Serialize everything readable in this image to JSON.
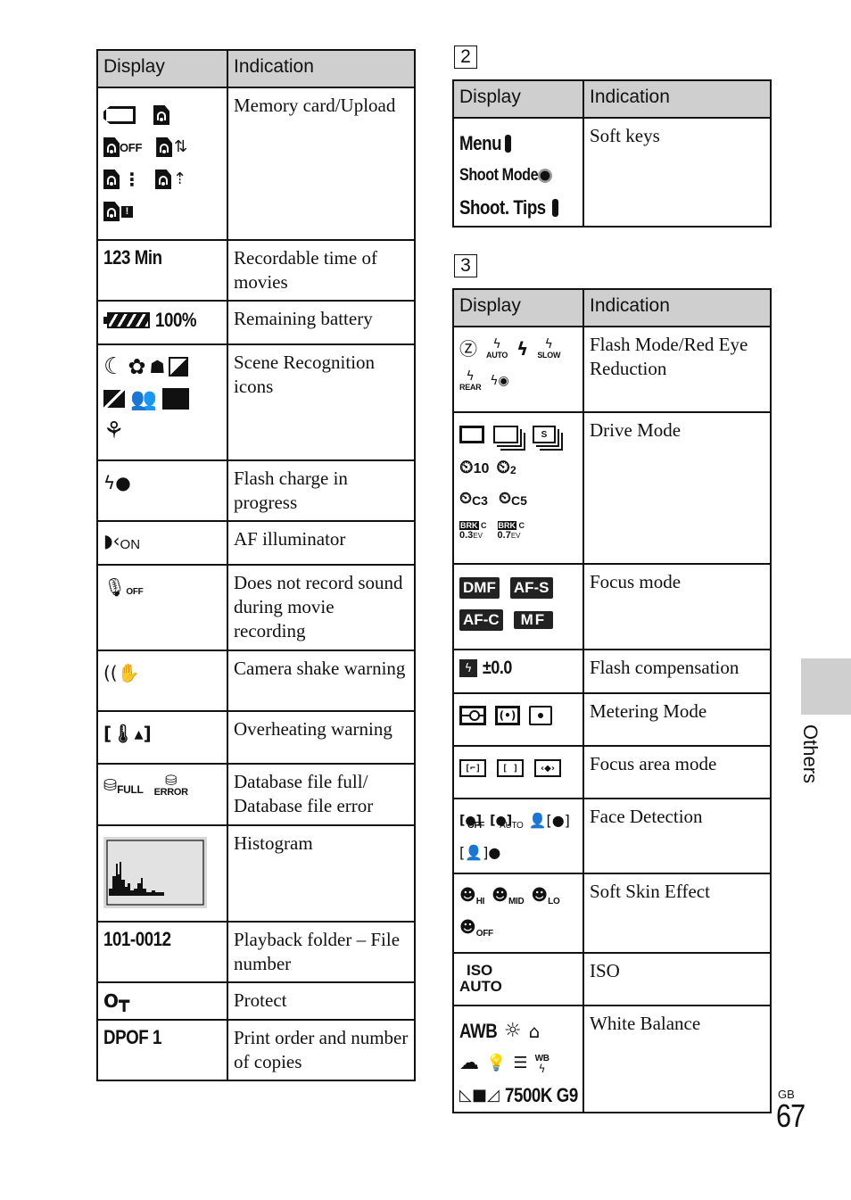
{
  "left_table": {
    "headers": {
      "display": "Display",
      "indication": "Indication"
    },
    "rows": [
      {
        "display_icons": [
          "memory-card-icon",
          "upload-icon",
          "upload-off-icon",
          "upload-transfer-icon",
          "upload-waiting-icon",
          "upload-progress-icon",
          "upload-error-icon"
        ],
        "icon_texts": {
          "off": "OFF"
        },
        "indication": "Memory card/Upload"
      },
      {
        "display_text": "123 Min",
        "indication": "Recordable time of movies"
      },
      {
        "display_icons": [
          "battery-icon"
        ],
        "display_text": "100%",
        "indication": "Remaining battery"
      },
      {
        "display_icons": [
          "night-scene-icon",
          "night-portrait-icon",
          "night-portrait-person-icon",
          "backlight-icon",
          "backlight-portrait-icon",
          "portrait-icon",
          "landscape-icon",
          "macro-icon"
        ],
        "indication": "Scene Recognition icons"
      },
      {
        "display_icons": [
          "flash-charge-icon"
        ],
        "indication": "Flash charge in progress"
      },
      {
        "display_icons": [
          "af-illuminator-icon"
        ],
        "display_text": "ON",
        "indication": "AF illuminator"
      },
      {
        "display_icons": [
          "microphone-off-icon"
        ],
        "display_text": "OFF",
        "indication": "Does not record sound during movie recording"
      },
      {
        "display_icons": [
          "camera-shake-icon"
        ],
        "indication": "Camera shake warning"
      },
      {
        "display_icons": [
          "overheating-icon"
        ],
        "indication": "Overheating warning"
      },
      {
        "display_icons": [
          "database-full-icon",
          "database-error-icon"
        ],
        "display_texts": [
          "FULL",
          "ERROR"
        ],
        "indication": "Database file full/ Database file error"
      },
      {
        "display_icons": [
          "histogram-icon"
        ],
        "indication": "Histogram"
      },
      {
        "display_text": "101-0012",
        "indication": "Playback folder – File number"
      },
      {
        "display_icons": [
          "protect-key-icon"
        ],
        "indication": "Protect"
      },
      {
        "display_text": "DPOF 1",
        "indication": "Print order and number of copies"
      }
    ]
  },
  "section2": {
    "number": "2",
    "headers": {
      "display": "Display",
      "indication": "Indication"
    },
    "row": {
      "labels": [
        "Menu",
        "Shoot Mode",
        "Shoot. Tips"
      ],
      "indication": "Soft keys"
    }
  },
  "section3": {
    "number": "3",
    "headers": {
      "display": "Display",
      "indication": "Indication"
    },
    "rows": [
      {
        "display_texts": [
          "AUTO",
          "SLOW",
          "REAR"
        ],
        "indication": "Flash Mode/Red Eye Reduction"
      },
      {
        "display_texts": [
          "10",
          "2",
          "C3",
          "C5",
          "BRK",
          "C",
          "0.3",
          "EV",
          "BRK",
          "C",
          "0.7",
          "EV",
          "S"
        ],
        "indication": "Drive Mode"
      },
      {
        "display_texts": [
          "DMF",
          "AF-S",
          "AF-C",
          "MF"
        ],
        "indication": "Focus mode"
      },
      {
        "display_text": "±0.0",
        "indication": "Flash compensation"
      },
      {
        "indication": "Metering Mode"
      },
      {
        "indication": "Focus area mode"
      },
      {
        "display_texts": [
          "OFF",
          "AUTO"
        ],
        "indication": "Face Detection"
      },
      {
        "display_texts": [
          "HI",
          "MID",
          "LO",
          "OFF"
        ],
        "indication": "Soft Skin Effect"
      },
      {
        "display_texts": [
          "ISO",
          "AUTO"
        ],
        "indication": "ISO"
      },
      {
        "display_texts": [
          "AWB",
          "WB",
          "7500K G9"
        ],
        "indication": "White Balance"
      }
    ]
  },
  "side_tab": {
    "label": "Others"
  },
  "footer": {
    "region": "GB",
    "page_number": "67"
  }
}
